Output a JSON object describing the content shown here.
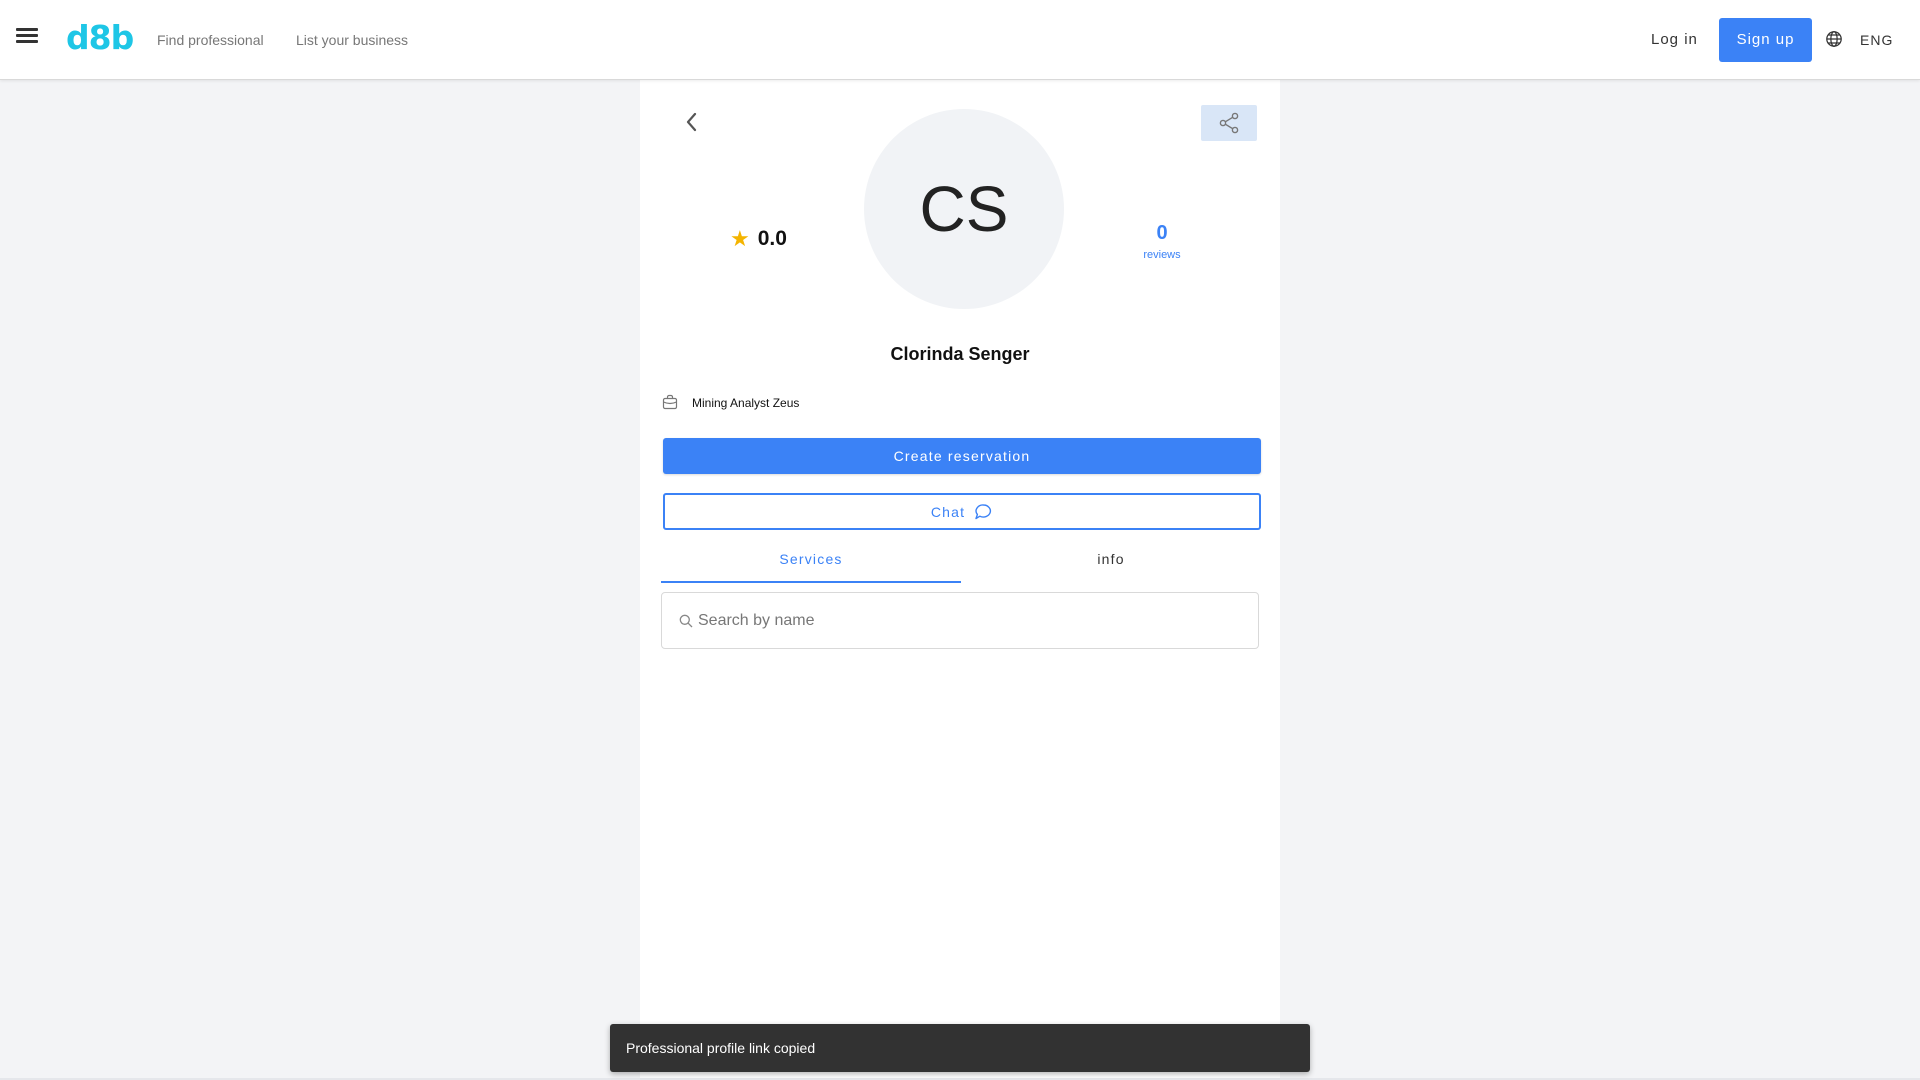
{
  "header": {
    "logo": "d8b",
    "nav": [
      "Find professional",
      "List your business"
    ],
    "login": "Log in",
    "signup": "Sign up",
    "language": "ENG"
  },
  "profile": {
    "initials": "CS",
    "rating": "0.0",
    "reviews_count": "0",
    "reviews_label": "reviews",
    "name": "Clorinda Senger",
    "job_title": "Mining Analyst Zeus"
  },
  "actions": {
    "reserve_label": "Create reservation",
    "chat_label": "Chat"
  },
  "tabs": {
    "items": [
      "Services",
      "info"
    ],
    "active": "Services"
  },
  "search": {
    "placeholder": "Search by name",
    "value": ""
  },
  "toast": {
    "message": "Professional profile link copied"
  },
  "colors": {
    "accent": "#3b82f6",
    "logo": "#1ec6e6",
    "star": "#f4b400",
    "toast_bg": "#323232"
  },
  "icons": [
    "menu-icon",
    "globe-icon",
    "chevron-left-icon",
    "share-icon",
    "star-icon",
    "briefcase-icon",
    "chat-bubble-icon",
    "search-icon"
  ]
}
